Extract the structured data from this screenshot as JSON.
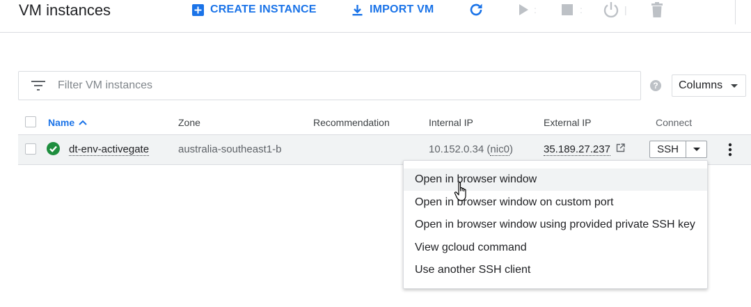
{
  "header": {
    "title": "VM instances",
    "create_label": "CREATE INSTANCE",
    "import_label": "IMPORT VM"
  },
  "filter": {
    "placeholder": "Filter VM instances",
    "value": ""
  },
  "columns_button": {
    "label": "Columns"
  },
  "table": {
    "headers": {
      "name": "Name",
      "zone": "Zone",
      "recommendation": "Recommendation",
      "internal_ip": "Internal IP",
      "external_ip": "External IP",
      "connect": "Connect"
    },
    "rows": [
      {
        "name": "dt-env-activegate",
        "zone": "australia-southeast1-b",
        "recommendation": "",
        "internal_ip": "10.152.0.34",
        "nic": "nic0",
        "external_ip": "35.189.27.237",
        "connect_label": "SSH",
        "status_color": "#1e8e3e"
      }
    ]
  },
  "ssh_menu": {
    "items": [
      {
        "label": "Open in browser window"
      },
      {
        "label": "Open in browser window on custom port"
      },
      {
        "label": "Open in browser window using provided private SSH key"
      },
      {
        "label": "View gcloud command"
      },
      {
        "label": "Use another SSH client"
      }
    ]
  },
  "colors": {
    "accent": "#1a73e8",
    "status_running": "#1e8e3e",
    "icon_disabled": "#bdc1c6"
  },
  "icons": {
    "create": "add-box-icon",
    "import": "import-icon",
    "refresh": "refresh-icon",
    "start": "play-icon",
    "stop": "stop-icon",
    "reset": "power-icon",
    "delete": "trash-icon"
  }
}
